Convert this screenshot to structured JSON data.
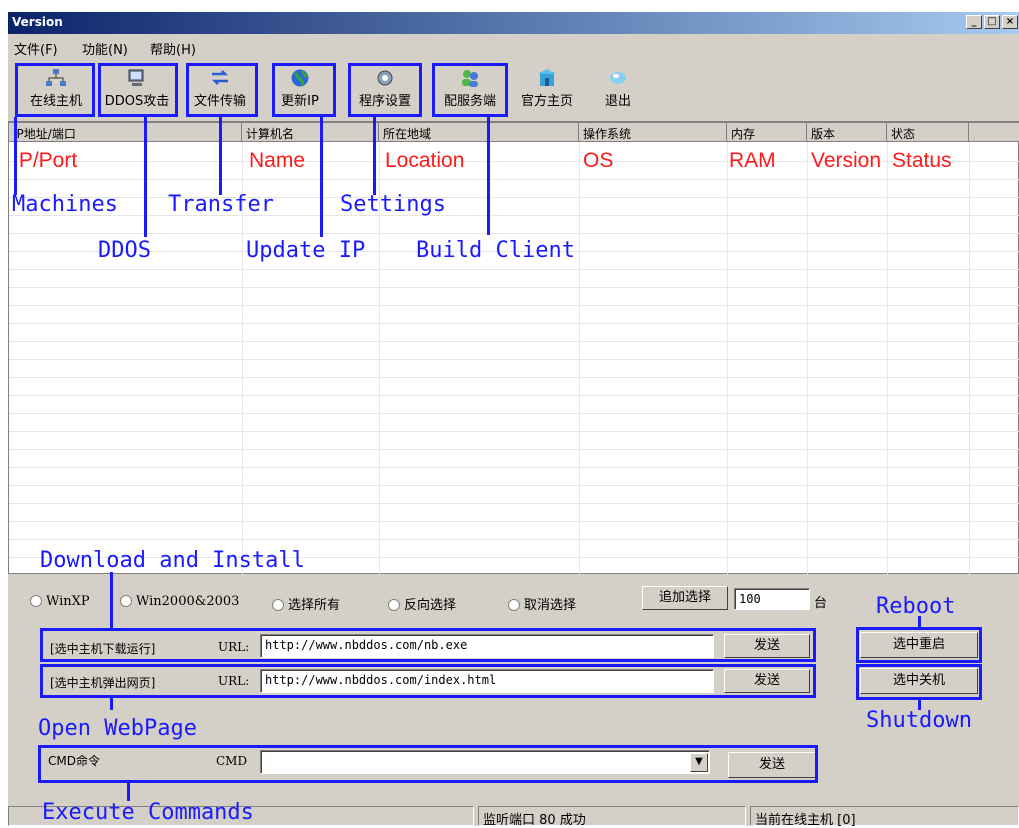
{
  "window": {
    "title": "Version"
  },
  "menu": [
    "文件(F)",
    "功能(N)",
    "帮助(H)"
  ],
  "toolbar": [
    {
      "label": "在线主机",
      "icon": "network-icon"
    },
    {
      "label": "DDOS攻击",
      "icon": "computer-icon"
    },
    {
      "label": "文件传输",
      "icon": "transfer-icon"
    },
    {
      "label": "更新IP",
      "icon": "globe-icon"
    },
    {
      "label": "程序设置",
      "icon": "settings-icon"
    },
    {
      "label": "配服务端",
      "icon": "users-icon"
    },
    {
      "label": "官方主页",
      "icon": "home-icon"
    },
    {
      "label": "退出",
      "icon": "exit-icon"
    }
  ],
  "table": {
    "columns": [
      "IP地址/端口",
      "计算机名",
      "所在地域",
      "操作系统",
      "内存",
      "版本",
      "状态"
    ]
  },
  "overlay": {
    "column_labels": [
      "IP/Port",
      "Name",
      "Location",
      "OS",
      "RAM",
      "Version",
      "Status"
    ],
    "annotations": {
      "machines": "Machines",
      "ddos": "DDOS",
      "transfer": "Transfer",
      "update_ip": "Update IP",
      "settings": "Settings",
      "build_client": "Build Client",
      "download_install": "Download and Install",
      "open_webpage": "Open WebPage",
      "execute_commands": "Execute Commands",
      "reboot": "Reboot",
      "shutdown": "Shutdown"
    }
  },
  "filters": {
    "options": [
      "WinXP",
      "Win2000&2003",
      "选择所有",
      "反向选择",
      "取消选择"
    ],
    "add_button": "追加选择",
    "count_value": "100",
    "count_unit": "台"
  },
  "download": {
    "label": "[选中主机下载运行]",
    "url_label": "URL:",
    "url": "http://www.nbddos.com/nb.exe",
    "send": "发送"
  },
  "webpage": {
    "label": "[选中主机弹出网页]",
    "url_label": "URL:",
    "url": "http://www.nbddos.com/index.html",
    "send": "发送"
  },
  "cmd": {
    "label": "CMD命令",
    "field_label": "CMD",
    "value": "",
    "send": "发送"
  },
  "actions": {
    "reboot": "选中重启",
    "shutdown": "选中关机"
  },
  "status": {
    "listen": "监听端口 80 成功",
    "online": "当前在线主机 [0]"
  }
}
